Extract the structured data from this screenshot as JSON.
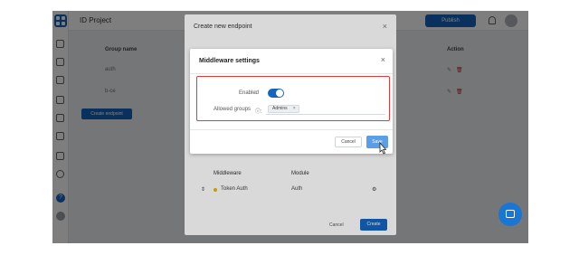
{
  "header": {
    "project": "ID Project",
    "workspace": "Publish"
  },
  "table": {
    "col_group": "Group name",
    "col_action": "Action",
    "rows": [
      "auth",
      "b-ce"
    ],
    "add_button": "Create endpoint"
  },
  "outer_modal": {
    "title": "Create new endpoint",
    "col_middleware": "Middleware",
    "col_module": "Module",
    "row_middleware": "Token Auth",
    "row_module": "Auth",
    "cancel": "Cancel",
    "create": "Create"
  },
  "dialog": {
    "title": "Middleware settings",
    "enabled_label": "Enabled",
    "groups_label": "Allowed groups",
    "tag": "Admins",
    "tag_remove": "×",
    "cancel": "Cancel",
    "save": "Save",
    "close": "×"
  },
  "colors": {
    "accent": "#1565c0",
    "highlight": "#e53935"
  },
  "icons": [
    "close-icon",
    "help-icon",
    "info-icon",
    "chat-icon",
    "bell-icon",
    "edit-icon",
    "delete-icon"
  ]
}
